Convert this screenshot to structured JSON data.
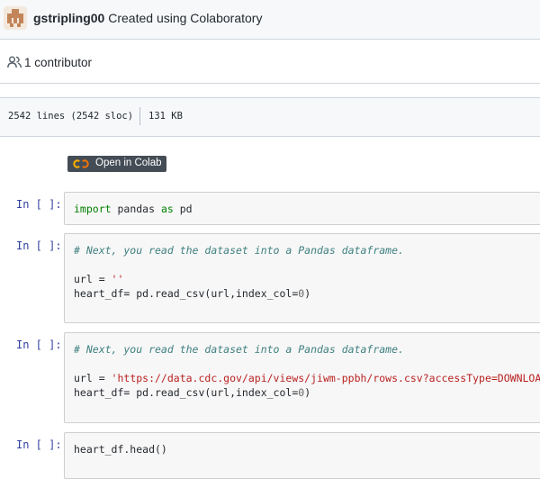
{
  "commit": {
    "author": "gstripling00",
    "message": "Created using Colaboratory"
  },
  "contributors": {
    "label": "1 contributor"
  },
  "file_info": {
    "lines": "2542 lines (2542 sloc)",
    "size": "131 KB"
  },
  "colab_badge": {
    "label": "Open in Colab"
  },
  "cells": [
    {
      "prompt": "In [ ]:",
      "lines": [
        [
          {
            "t": "import",
            "c": "kw"
          },
          {
            "t": " pandas ",
            "c": ""
          },
          {
            "t": "as",
            "c": "kw"
          },
          {
            "t": " pd",
            "c": ""
          }
        ]
      ]
    },
    {
      "prompt": "In [ ]:",
      "lines": [
        [
          {
            "t": "# Next, you read the dataset into a Pandas dataframe.",
            "c": "cm"
          }
        ],
        [],
        [
          {
            "t": "url = ",
            "c": ""
          },
          {
            "t": "''",
            "c": "str"
          }
        ],
        [
          {
            "t": "heart_df= pd.read_csv(url,index_col=",
            "c": ""
          },
          {
            "t": "0",
            "c": "num"
          },
          {
            "t": ")",
            "c": ""
          }
        ]
      ]
    },
    {
      "prompt": "In [ ]:",
      "lines": [
        [
          {
            "t": "# Next, you read the dataset into a Pandas dataframe.",
            "c": "cm"
          }
        ],
        [],
        [
          {
            "t": "url = ",
            "c": ""
          },
          {
            "t": "'https://data.cdc.gov/api/views/jiwm-ppbh/rows.csv?accessType=DOWNLOAD'",
            "c": "str"
          }
        ],
        [
          {
            "t": "heart_df= pd.read_csv(url,index_col=",
            "c": ""
          },
          {
            "t": "0",
            "c": "num"
          },
          {
            "t": ")",
            "c": ""
          }
        ]
      ]
    },
    {
      "prompt": "In [ ]:",
      "lines": [
        [
          {
            "t": "heart_df.head()",
            "c": ""
          }
        ]
      ]
    }
  ]
}
